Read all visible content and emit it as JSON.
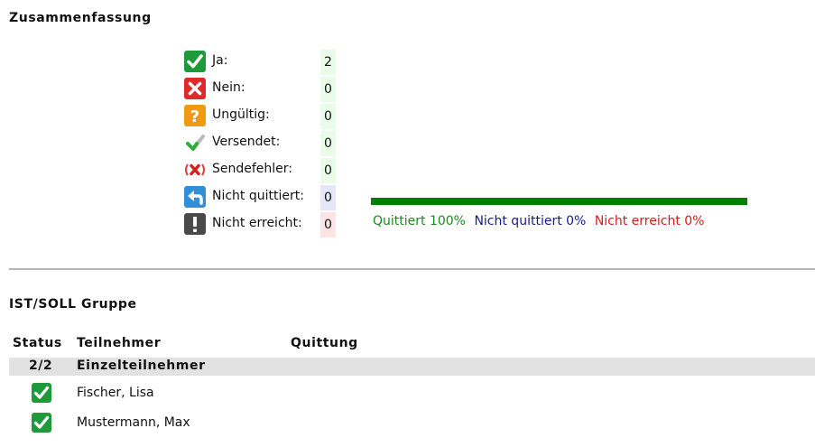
{
  "summary": {
    "title": "Zusammenfassung",
    "stats": [
      {
        "icon": "check-green-icon",
        "label": "Ja:",
        "value": "2",
        "bg": "#e8fce8"
      },
      {
        "icon": "x-red-icon",
        "label": "Nein:",
        "value": "0",
        "bg": "#e8fce8"
      },
      {
        "icon": "question-orange-icon",
        "label": "Ungültig:",
        "value": "0",
        "bg": "#e8fce8"
      },
      {
        "icon": "sent-check-icon",
        "label": "Versendet:",
        "value": "0",
        "bg": "#e8fce8"
      },
      {
        "icon": "send-error-icon",
        "label": "Sendefehler:",
        "value": "0",
        "bg": "#e8fce8"
      },
      {
        "icon": "unacknowledged-arrow-icon",
        "label": "Nicht quittiert:",
        "value": "0",
        "bg": "#e6e6fa"
      },
      {
        "icon": "exclamation-icon",
        "label": "Nicht erreicht:",
        "value": "0",
        "bg": "#fce4e4"
      }
    ],
    "bar": {
      "quittiert_fraction": 1.0,
      "nicht_quittiert_fraction": 0.0,
      "nicht_erreicht_fraction": 0.0,
      "color": "#008000",
      "legend_quittiert": "Quittiert 100%",
      "legend_nicht_quittiert": "Nicht quittiert 0%",
      "legend_nicht_erreicht": "Nicht erreicht 0%"
    }
  },
  "group": {
    "title": "IST/SOLL Gruppe",
    "columns": {
      "status": "Status",
      "teilnehmer": "Teilnehmer",
      "quittung": "Quittung"
    },
    "row": {
      "count": "2/2",
      "name": "Einzelteilnehmer"
    },
    "participants": [
      {
        "name": "Fischer, Lisa",
        "icon": "check-green-icon"
      },
      {
        "name": "Mustermann, Max",
        "icon": "check-green-icon"
      }
    ]
  }
}
